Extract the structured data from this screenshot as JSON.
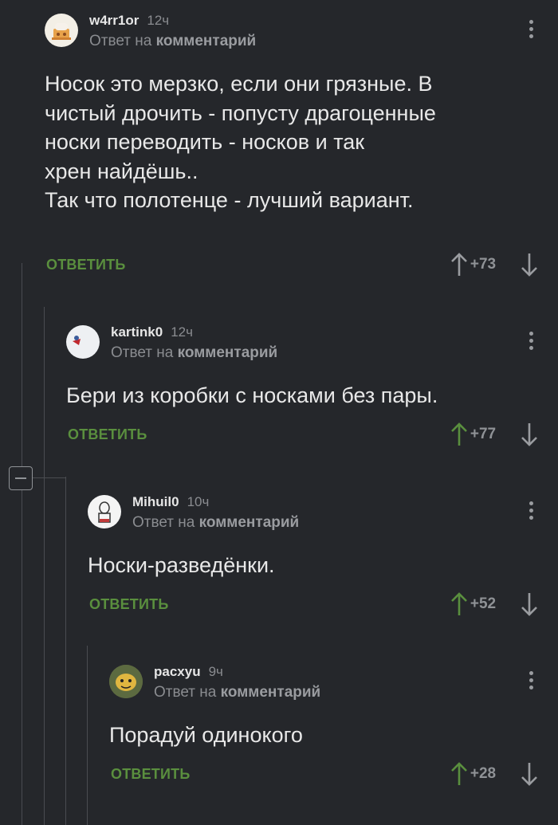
{
  "comments": [
    {
      "username": "w4rr1or",
      "time": "12ч",
      "reply_prefix": "Ответ на",
      "reply_target": "комментарий",
      "text": "Носок это мерзко, если они грязные. В\nчистый дрочить - попусту драгоценные\nноски переводить - носков и так\nхрен найдёшь..\nТак что полотенце - лучший вариант.",
      "reply_label": "ОТВЕТИТЬ",
      "score": "+73",
      "upvoted": false
    },
    {
      "username": "kartink0",
      "time": "12ч",
      "reply_prefix": "Ответ на",
      "reply_target": "комментарий",
      "text": "Бери из коробки с носками без пары.",
      "reply_label": "ОТВЕТИТЬ",
      "score": "+77",
      "upvoted": true
    },
    {
      "username": "Mihuil0",
      "time": "10ч",
      "reply_prefix": "Ответ на",
      "reply_target": "комментарий",
      "text": "Носки-разведёнки.",
      "reply_label": "ОТВЕТИТЬ",
      "score": "+52",
      "upvoted": true
    },
    {
      "username": "pacxyu",
      "time": "9ч",
      "reply_prefix": "Ответ на",
      "reply_target": "комментарий",
      "text": "Порадуй одинокого",
      "reply_label": "ОТВЕТИТЬ",
      "score": "+28",
      "upvoted": true
    }
  ],
  "colors": {
    "background": "#25272b",
    "upvote_active": "#5a8f3e",
    "vote_inactive": "#9a9ca0",
    "reply_button": "#5a8f3e"
  }
}
